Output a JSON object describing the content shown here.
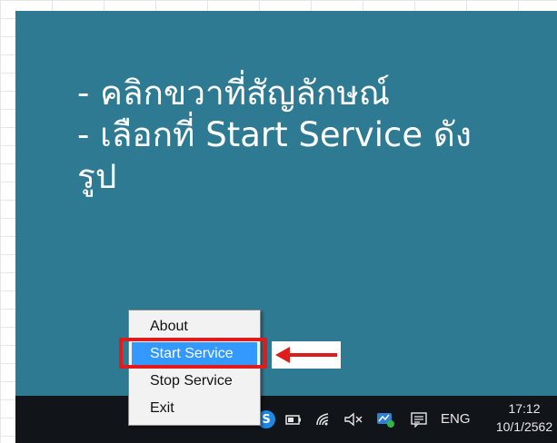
{
  "slide": {
    "line1": "- คลิกขวาที่สัญลักษณ์",
    "line2": "- เลือกที่ Start Service ดัง",
    "line3": "รูป"
  },
  "context_menu": {
    "items": [
      {
        "label": "About"
      },
      {
        "label": "Start Service"
      },
      {
        "label": "Stop Service"
      },
      {
        "label": "Exit"
      }
    ],
    "highlighted_item": "Start Service"
  },
  "taskbar": {
    "language": "ENG",
    "time": "17:12",
    "date": "10/1/2562"
  },
  "colors": {
    "slide_background": "#2e7a93",
    "highlight": "#3399ff",
    "annotation_red": "#e01b1b",
    "taskbar": "#111418"
  }
}
